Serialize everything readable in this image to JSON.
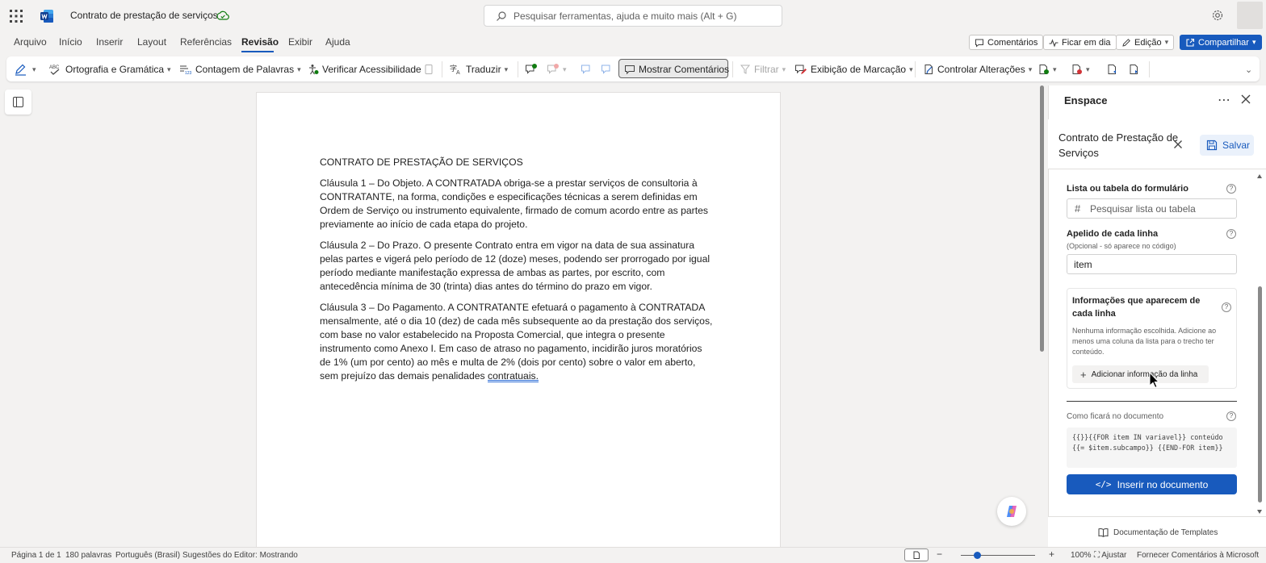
{
  "app": {
    "doc_title": "Contrato de prestação de serviços",
    "search_placeholder": "Pesquisar ferramentas, ajuda e muito mais (Alt + G)",
    "accent": "#185abd"
  },
  "menu": {
    "items": [
      "Arquivo",
      "Início",
      "Inserir",
      "Layout",
      "Referências",
      "Revisão",
      "Exibir",
      "Ajuda"
    ],
    "active": "Revisão",
    "right": {
      "comments": "Comentários",
      "catch_up": "Ficar em dia",
      "editing": "Edição",
      "share": "Compartilhar"
    }
  },
  "ribbon": {
    "spelling": "Ortografia e Gramática",
    "word_count": "Contagem de Palavras",
    "accessibility": "Verificar Acessibilidade",
    "translate": "Traduzir",
    "show_comments": "Mostrar Comentários",
    "filter": "Filtrar",
    "markup_view": "Exibição de Marcação",
    "track_changes": "Controlar Alterações"
  },
  "document": {
    "heading": "CONTRATO DE PRESTAÇÃO DE SERVIÇOS",
    "p1": "Cláusula 1 – Do Objeto. A CONTRATADA obriga-se a prestar serviços de consultoria à CONTRATANTE, na forma, condições e especificações técnicas a serem definidas em Ordem de Serviço ou instrumento equivalente, firmado de comum acordo entre as partes previamente ao início de cada etapa do projeto.",
    "p2": "Cláusula 2 – Do Prazo. O presente Contrato entra em vigor na data de sua assinatura pelas partes e vigerá pelo período de 12 (doze) meses, podendo ser prorrogado por igual período mediante manifestação expressa de ambas as partes, por escrito, com antecedência mínima de 30 (trinta) dias antes do término do prazo em vigor.",
    "p3_main": "Cláusula 3 – Do Pagamento. A CONTRATANTE efetuará o pagamento à CONTRATADA mensalmente, até o dia 10 (dez) de cada mês subsequente ao da prestação dos serviços, com base no valor estabelecido na Proposta Comercial, que integra o presente instrumento como Anexo I. Em caso de atraso no pagamento, incidirão juros moratórios de 1% (um por cento) ao mês e multa de 2% (dois por cento) sobre o valor em aberto, sem prejuízo das demais penalidades ",
    "p3_flagged": "contratuais."
  },
  "pane": {
    "title": "Enspace",
    "template_title": "Contrato de Prestação de Serviços",
    "save": "Salvar",
    "list_label": "Lista ou tabela do formulário",
    "list_placeholder": "Pesquisar lista ou tabela",
    "alias_label": "Apelido de cada linha",
    "alias_sub": "(Opcional - só aparece no código)",
    "alias_value": "item",
    "info_title": "Informações que aparecem de cada linha",
    "info_desc": "Nenhuma informação escolhida. Adicione ao menos uma coluna da lista para o trecho ter conteúdo.",
    "add_info": "Adicionar informação da linha",
    "preview_label": "Como ficará no documento",
    "preview_code": "{{}}{{FOR item IN variavel}} conteúdo {{= $item.subcampo}} {{END-FOR item}}",
    "insert": "Inserir no documento",
    "docs": "Documentação de Templates"
  },
  "status": {
    "page": "Página 1 de 1",
    "words": "180 palavras",
    "language": "Português (Brasil)",
    "editor": "Sugestões do Editor: Mostrando",
    "zoom": "100%",
    "fit": "Ajustar",
    "feedback": "Fornecer Comentários à Microsoft"
  }
}
